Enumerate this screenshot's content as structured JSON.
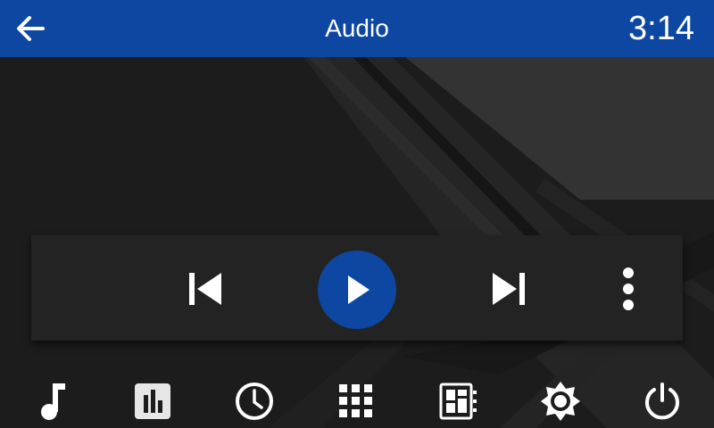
{
  "header": {
    "title": "Audio",
    "clock": "3:14",
    "back_icon": "arrow-back-icon"
  },
  "player": {
    "controls": [
      {
        "name": "previous",
        "icon": "skip-previous-icon"
      },
      {
        "name": "play",
        "icon": "play-icon"
      },
      {
        "name": "next",
        "icon": "skip-next-icon"
      },
      {
        "name": "more",
        "icon": "more-vertical-icon"
      }
    ]
  },
  "dock": {
    "items": [
      {
        "name": "music",
        "icon": "music-note-icon"
      },
      {
        "name": "equalizer",
        "icon": "equalizer-icon"
      },
      {
        "name": "clock",
        "icon": "clock-icon"
      },
      {
        "name": "apps",
        "icon": "app-grid-icon"
      },
      {
        "name": "dashboard",
        "icon": "dashboard-icon"
      },
      {
        "name": "brightness",
        "icon": "brightness-icon"
      },
      {
        "name": "power",
        "icon": "power-icon"
      }
    ]
  },
  "colors": {
    "accent": "#0d47a1",
    "background": "#1c1c1c",
    "panel": "#232323",
    "icon": "#ffffff"
  }
}
